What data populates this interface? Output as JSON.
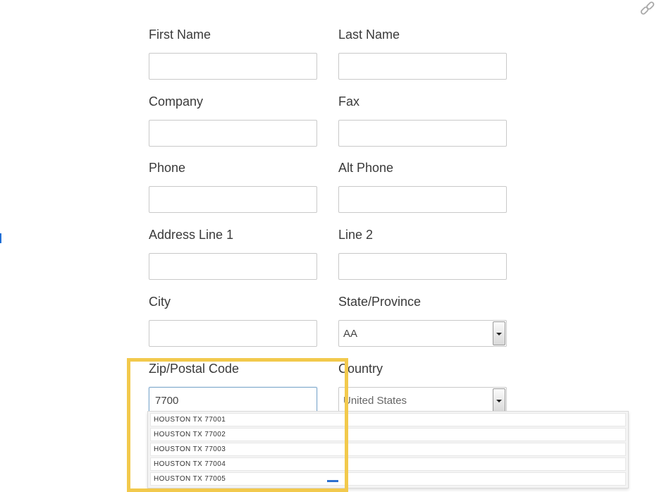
{
  "form": {
    "first_name": {
      "label": "First Name",
      "value": ""
    },
    "last_name": {
      "label": "Last Name",
      "value": ""
    },
    "company": {
      "label": "Company",
      "value": ""
    },
    "fax": {
      "label": "Fax",
      "value": ""
    },
    "phone": {
      "label": "Phone",
      "value": ""
    },
    "alt_phone": {
      "label": "Alt Phone",
      "value": ""
    },
    "address_line_1": {
      "label": "Address Line 1",
      "value": ""
    },
    "line_2": {
      "label": "Line 2",
      "value": ""
    },
    "city": {
      "label": "City",
      "value": ""
    },
    "state": {
      "label": "State/Province",
      "selected": "AA"
    },
    "zip": {
      "label": "Zip/Postal Code",
      "value": "7700"
    },
    "country": {
      "label": "Country",
      "selected": "United States"
    }
  },
  "autocomplete": {
    "items": [
      "HOUSTON TX 77001",
      "HOUSTON TX 77002",
      "HOUSTON TX 77003",
      "HOUSTON TX 77004",
      "HOUSTON TX 77005"
    ]
  },
  "icons": {
    "top_right": "link-icon"
  },
  "colors": {
    "highlight": "#f2c94c",
    "accent": "#2c6fd0",
    "focus_border": "#7fa9cc"
  }
}
